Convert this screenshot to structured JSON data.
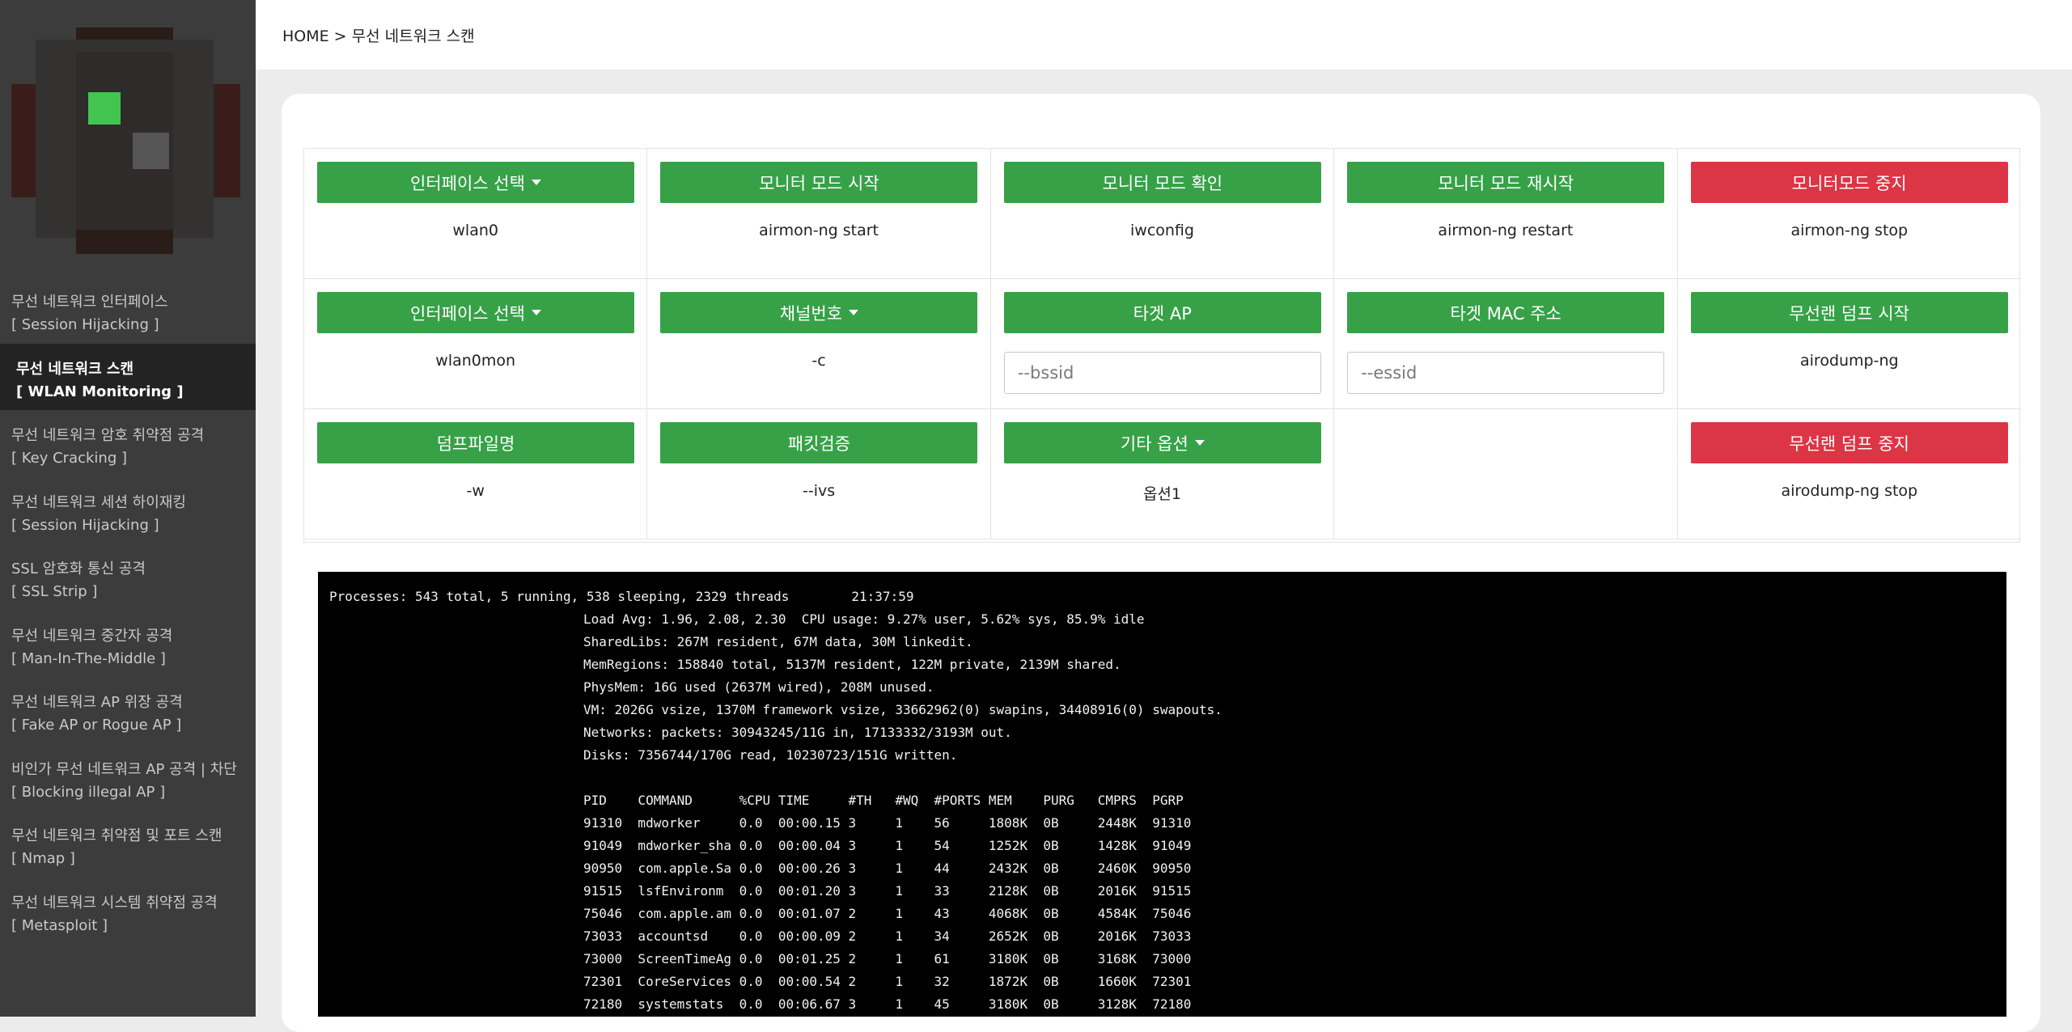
{
  "breadcrumb": "HOME > 무선 네트워크 스캔",
  "sidebar": {
    "items": [
      {
        "title": "무선 네트워크 인터페이스",
        "subtitle": "[ Session Hijacking ]"
      },
      {
        "title": "무선 네트워크 스캔",
        "subtitle": "[ WLAN Monitoring ]"
      },
      {
        "title": "무선 네트워크 암호 취약점 공격",
        "subtitle": "[ Key Cracking ]"
      },
      {
        "title": "무선 네트워크 세션 하이재킹",
        "subtitle": "[ Session Hijacking ]"
      },
      {
        "title": "SSL 암호화 통신 공격",
        "subtitle": "[ SSL Strip ]"
      },
      {
        "title": "무선 네트워크 중간자 공격",
        "subtitle": "[ Man-In-The-Middle ]"
      },
      {
        "title": "무선 네트워크 AP 위장 공격",
        "subtitle": "[ Fake AP or Rogue AP ]"
      },
      {
        "title": "비인가 무선 네트워크 AP 공격 | 차단",
        "subtitle": "[ Blocking illegal AP ]"
      },
      {
        "title": "무선 네트워크 취약점 및 포트 스캔",
        "subtitle": "[ Nmap ]"
      },
      {
        "title": "무선 네트워크 시스템 취약점 공격",
        "subtitle": "[ Metasploit ]"
      }
    ],
    "active_index": 1
  },
  "colors": {
    "green": "#37a148",
    "red": "#dc3545",
    "sidebar": "#3c3c3c",
    "sidebar_active": "#232323"
  },
  "controls": {
    "row1": [
      {
        "label": "인터페이스 선택",
        "value": "wlan0",
        "dropdown": true
      },
      {
        "label": "모니터 모드 시작",
        "value": "airmon-ng start"
      },
      {
        "label": "모니터 모드 확인",
        "value": "iwconfig"
      },
      {
        "label": "모니터 모드 재시작",
        "value": "airmon-ng restart"
      },
      {
        "label": "모니터모드 중지",
        "value": "airmon-ng stop",
        "color": "red"
      }
    ],
    "row2": [
      {
        "label": "인터페이스 선택",
        "value": "wlan0mon",
        "dropdown": true
      },
      {
        "label": "채널번호",
        "value": "-c",
        "dropdown": true
      },
      {
        "label": "타겟 AP",
        "placeholder": "--bssid"
      },
      {
        "label": "타겟 MAC 주소",
        "placeholder": "--essid"
      },
      {
        "label": "무선랜 덤프 시작",
        "value": "airodump-ng"
      }
    ],
    "row3": [
      {
        "label": "덤프파일명",
        "value": "-w"
      },
      {
        "label": "패킷검증",
        "value": "--ivs"
      },
      {
        "label": "기타 옵션",
        "value": "옵션1",
        "dropdown": true
      },
      {
        "label": "무선랜 덤프 중지",
        "value": "airodump-ng stop",
        "color": "red"
      }
    ]
  },
  "terminal": {
    "header": "Processes: 543 total, 5 running, 538 sleeping, 2329 threads        21:37:59",
    "stats": [
      "Load Avg: 1.96, 2.08, 2.30  CPU usage: 9.27% user, 5.62% sys, 85.9% idle",
      "SharedLibs: 267M resident, 67M data, 30M linkedit.",
      "MemRegions: 158840 total, 5137M resident, 122M private, 2139M shared.",
      "PhysMem: 16G used (2637M wired), 208M unused.",
      "VM: 2026G vsize, 1370M framework vsize, 33662962(0) swapins, 34408916(0) swapouts.",
      "Networks: packets: 30943245/11G in, 17133332/3193M out.",
      "Disks: 7356744/170G read, 10230723/151G written."
    ],
    "columns": "PID    COMMAND      %CPU TIME     #TH   #WQ  #PORTS MEM    PURG   CMPRS  PGRP",
    "processes": [
      "91310  mdworker     0.0  00:00.15 3     1    56     1808K  0B     2448K  91310",
      "91049  mdworker_sha 0.0  00:00.04 3     1    54     1252K  0B     1428K  91049",
      "90950  com.apple.Sa 0.0  00:00.26 3     1    44     2432K  0B     2460K  90950",
      "91515  lsfEnvironm  0.0  00:01.20 3     1    33     2128K  0B     2016K  91515",
      "75046  com.apple.am 0.0  00:01.07 2     1    43     4068K  0B     4584K  75046",
      "73033  accountsd    0.0  00:00.09 2     1    34     2652K  0B     2016K  73033",
      "73000  ScreenTimeAg 0.0  00:01.25 2     1    61     3180K  0B     3168K  73000",
      "72301  CoreServices 0.0  00:00.54 2     1    32     1872K  0B     1660K  72301",
      "72180  systemstats  0.0  00:06.67 3     1    45     3180K  0B     3128K  72180"
    ]
  }
}
